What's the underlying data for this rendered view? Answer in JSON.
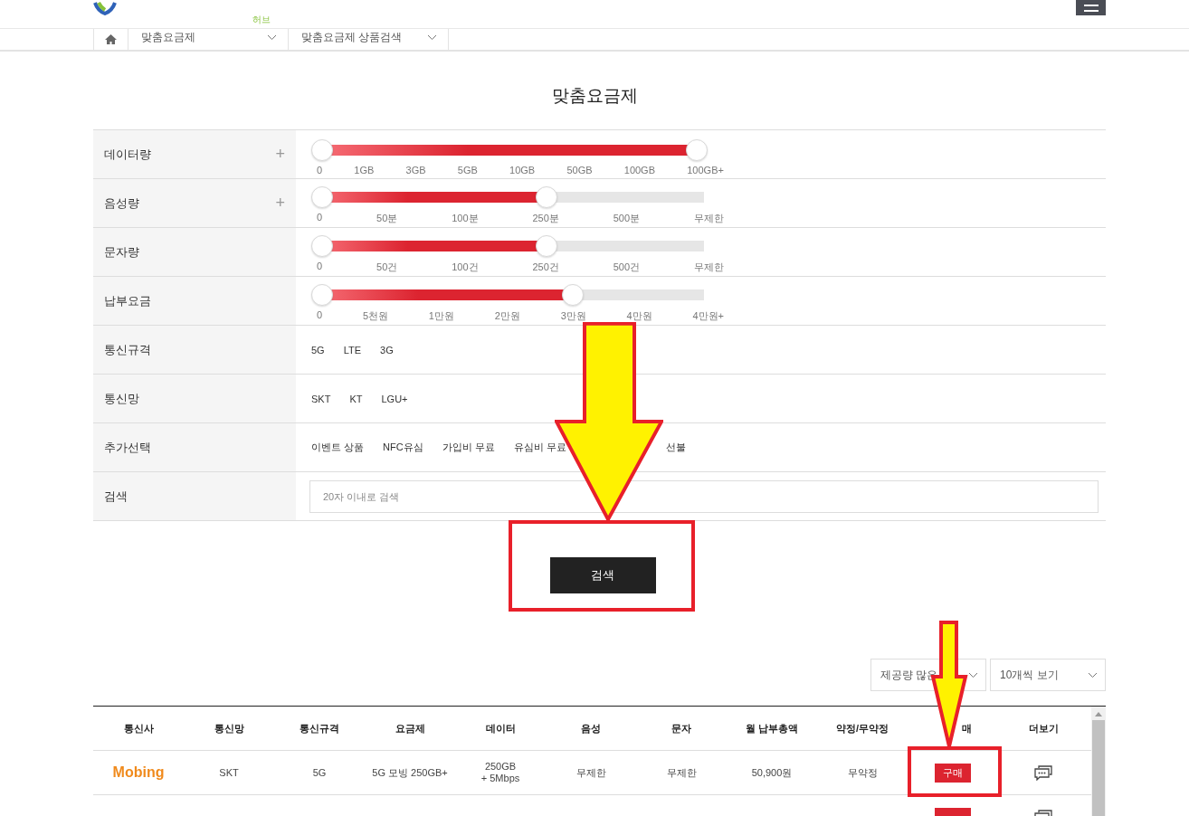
{
  "header": {
    "logo_sub": "허브"
  },
  "breadcrumb": [
    "맞춤요금제",
    "맞춤요금제 상품검색"
  ],
  "title": "맞춤요금제",
  "filters": [
    {
      "kind": "slider",
      "label": "데이터량",
      "toggle": "+",
      "level": 1,
      "ticks": [
        "0",
        "1GB",
        "3GB",
        "5GB",
        "10GB",
        "50GB",
        "100GB",
        "100GB+"
      ]
    },
    {
      "kind": "slider",
      "label": "음성량",
      "toggle": "+",
      "level": 0.6,
      "ticks": [
        "0",
        "50분",
        "100분",
        "250분",
        "500분",
        "무제한"
      ]
    },
    {
      "kind": "slider",
      "label": "문자량",
      "level": 0.6,
      "ticks": [
        "0",
        "50건",
        "100건",
        "250건",
        "500건",
        "무제한"
      ]
    },
    {
      "kind": "slider",
      "label": "납부요금",
      "level": 0.67,
      "ticks": [
        "0",
        "5천원",
        "1만원",
        "2만원",
        "3만원",
        "4만원",
        "4만원+"
      ]
    },
    {
      "kind": "options",
      "label": "통신규격",
      "options": [
        "5G",
        "LTE",
        "3G"
      ]
    },
    {
      "kind": "options",
      "label": "통신망",
      "options": [
        "SKT",
        "KT",
        "LGU+"
      ]
    },
    {
      "kind": "options",
      "label": "추가선택",
      "options": [
        "이벤트 상품",
        "NFC유심",
        "가입비 무료",
        "유심비 무료",
        "선불"
      ]
    },
    {
      "kind": "search",
      "label": "검색",
      "placeholder": "20자 이내로 검색"
    }
  ],
  "search_button": "검색",
  "sort": [
    "제공량 많은",
    "10개씩 보기"
  ],
  "table": {
    "columns": [
      "통신사",
      "통신망",
      "통신규격",
      "요금제",
      "데이터",
      "음성",
      "문자",
      "월 납부총액",
      "약정/무약정",
      "매",
      "더보기"
    ],
    "rows": [
      {
        "carrier": "Mobing",
        "network": "SKT",
        "standard": "5G",
        "plan": "5G 모빙 250GB+",
        "data": [
          "250GB",
          "+ 5Mbps"
        ],
        "voice": "무제한",
        "sms": "무제한",
        "total": "50,900원",
        "contract": "무약정",
        "buy": "구매"
      },
      {}
    ]
  }
}
